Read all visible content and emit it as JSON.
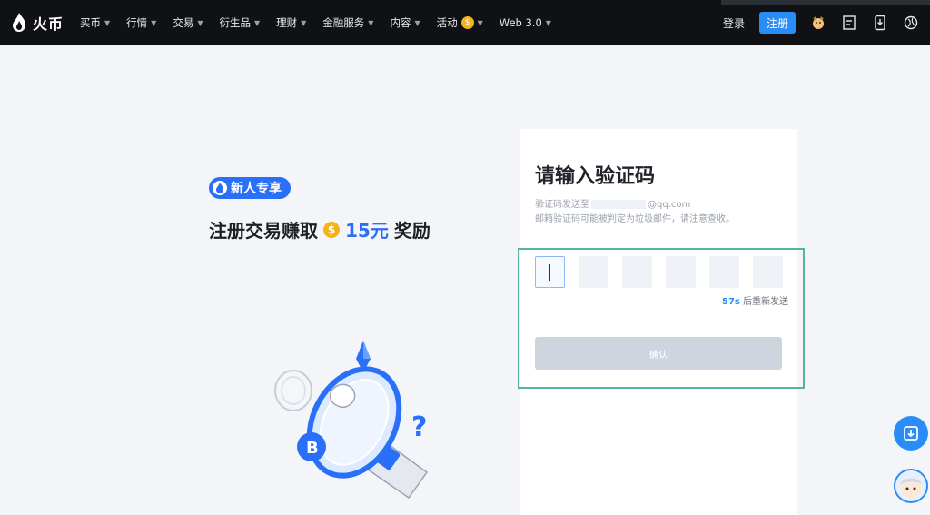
{
  "brand": {
    "name": "火币"
  },
  "nav": {
    "items": [
      {
        "label": "买币"
      },
      {
        "label": "行情"
      },
      {
        "label": "交易"
      },
      {
        "label": "衍生品"
      },
      {
        "label": "理财"
      },
      {
        "label": "金融服务"
      },
      {
        "label": "内容"
      },
      {
        "label": "活动"
      },
      {
        "label": "Web 3.0"
      }
    ],
    "login": "登录",
    "signup": "注册"
  },
  "promo": {
    "badge": "新人专享",
    "title_prefix": "注册交易赚取",
    "amount": "15元",
    "title_suffix": "奖励"
  },
  "verify": {
    "title": "请输入验证码",
    "sent_to_prefix": "验证码发送至",
    "email_suffix": "@qq.com",
    "spam_notice": "邮箱验证码可能被判定为垃圾邮件，请注意查收。",
    "resend_seconds": "57s",
    "resend_text": "后重新发送",
    "confirm": "确认",
    "code_length": 6
  },
  "colors": {
    "accent": "#2a8df7",
    "highlight_border": "#56b49a",
    "topbar": "#0f1115"
  }
}
